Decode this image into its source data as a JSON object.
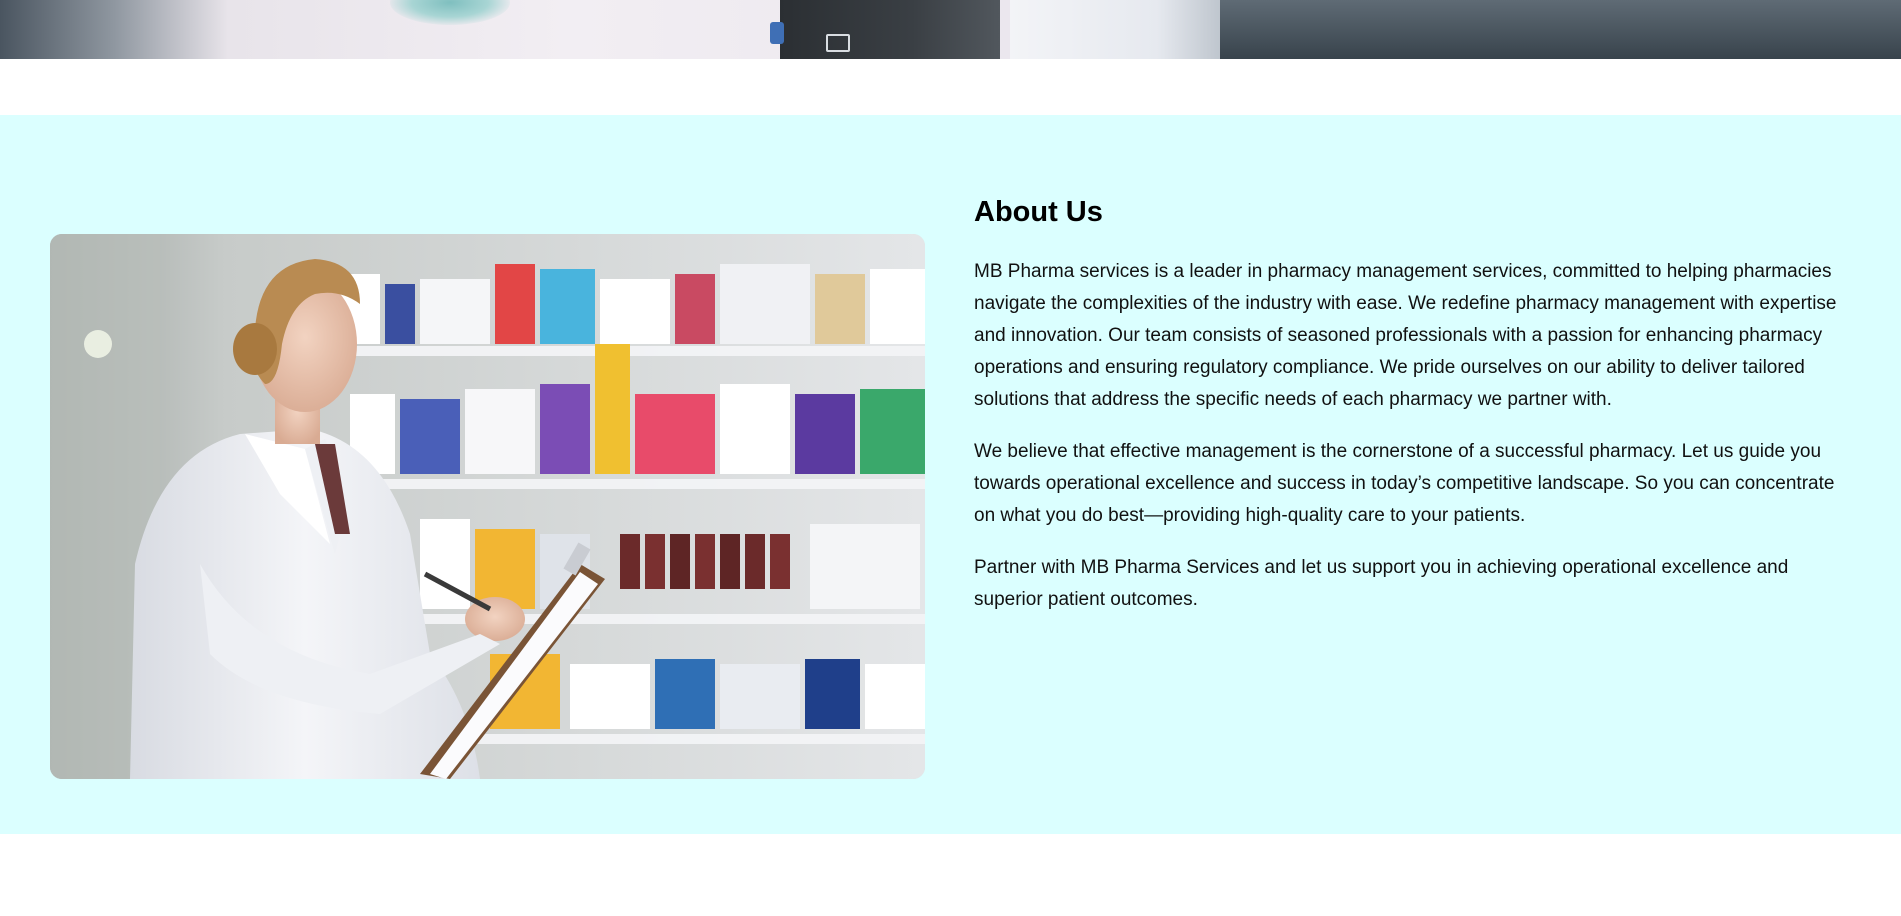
{
  "colors": {
    "section_background": "#dbffff",
    "page_background": "#ffffff",
    "text": "#111111"
  },
  "hero": {
    "image_description": "pharmacy-banner-photo"
  },
  "about": {
    "title": "About Us",
    "image_description": "pharmacist-with-clipboard-photo",
    "paragraphs": [
      "MB Pharma services is a leader in pharmacy management services, committed to helping pharmacies navigate the complexities of the industry with ease. We redefine pharmacy management with expertise and innovation. Our team consists of seasoned professionals with a passion for enhancing pharmacy operations and ensuring regulatory compliance. We pride ourselves on our ability to deliver tailored solutions that address the specific needs of each pharmacy we partner with.",
      "We believe that effective management is the cornerstone of a successful pharmacy. Let us guide you towards operational excellence and success in today’s competitive landscape. So you can concentrate on what you do best—providing high-quality care to your patients.",
      "Partner with MB Pharma Services and let us support you in achieving operational excellence and superior patient outcomes."
    ]
  }
}
